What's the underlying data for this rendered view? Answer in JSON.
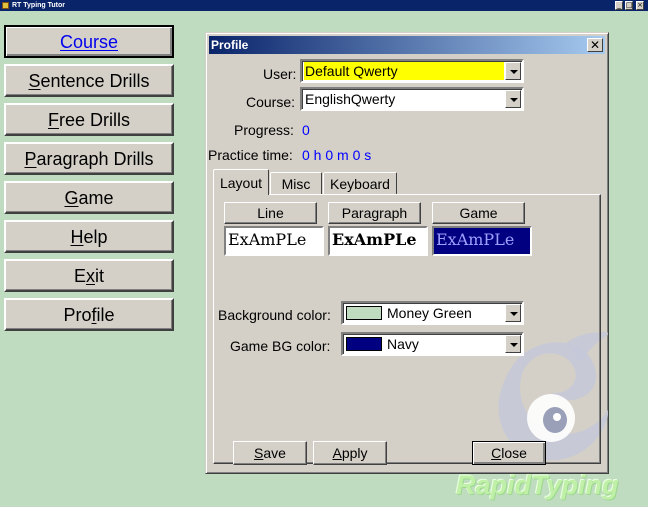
{
  "window": {
    "title": "RT Typing Tutor"
  },
  "menu": {
    "items": [
      {
        "key": "course",
        "pre": "",
        "ul": "C",
        "post": "ourse",
        "selected": true
      },
      {
        "key": "sentence-drills",
        "pre": "",
        "ul": "S",
        "post": "entence Drills"
      },
      {
        "key": "free-drills",
        "pre": "",
        "ul": "F",
        "post": "ree Drills"
      },
      {
        "key": "paragraph-drills",
        "pre": "",
        "ul": "P",
        "post": "aragraph Drills"
      },
      {
        "key": "game",
        "pre": "",
        "ul": "G",
        "post": "ame"
      },
      {
        "key": "help",
        "pre": "",
        "ul": "H",
        "post": "elp"
      },
      {
        "key": "exit",
        "pre": "E",
        "ul": "x",
        "post": "it"
      },
      {
        "key": "profile",
        "pre": "Pro",
        "ul": "f",
        "post": "ile"
      }
    ]
  },
  "dialog": {
    "title": "Profile",
    "close_glyph": "✕",
    "user": {
      "label": "User:",
      "value": "Default Qwerty",
      "highlight": "#ffff00"
    },
    "course": {
      "label": "Course:",
      "value": "EnglishQwerty"
    },
    "progress": {
      "label": "Progress:",
      "value": "0"
    },
    "practice_time": {
      "label": "Practice time:",
      "value": "0 h 0 m 0 s"
    },
    "tabs": [
      {
        "label": "Layout",
        "active": true
      },
      {
        "label": "Misc"
      },
      {
        "label": "Keyboard"
      }
    ],
    "layout": {
      "columns": [
        "Line",
        "Paragraph",
        "Game"
      ],
      "example_text": "ExAmPLe",
      "background_color": {
        "label": "Background color:",
        "value": "Money Green",
        "swatch": "#c0dcc0"
      },
      "game_bg_color": {
        "label": "Game BG color:",
        "value": "Navy",
        "swatch": "#000080"
      }
    },
    "buttons": {
      "save": {
        "ul": "S",
        "rest": "ave"
      },
      "apply": {
        "ul": "A",
        "rest": "pply"
      },
      "close": {
        "ul": "C",
        "rest": "lose"
      }
    }
  },
  "watermark": "RapidTyping"
}
